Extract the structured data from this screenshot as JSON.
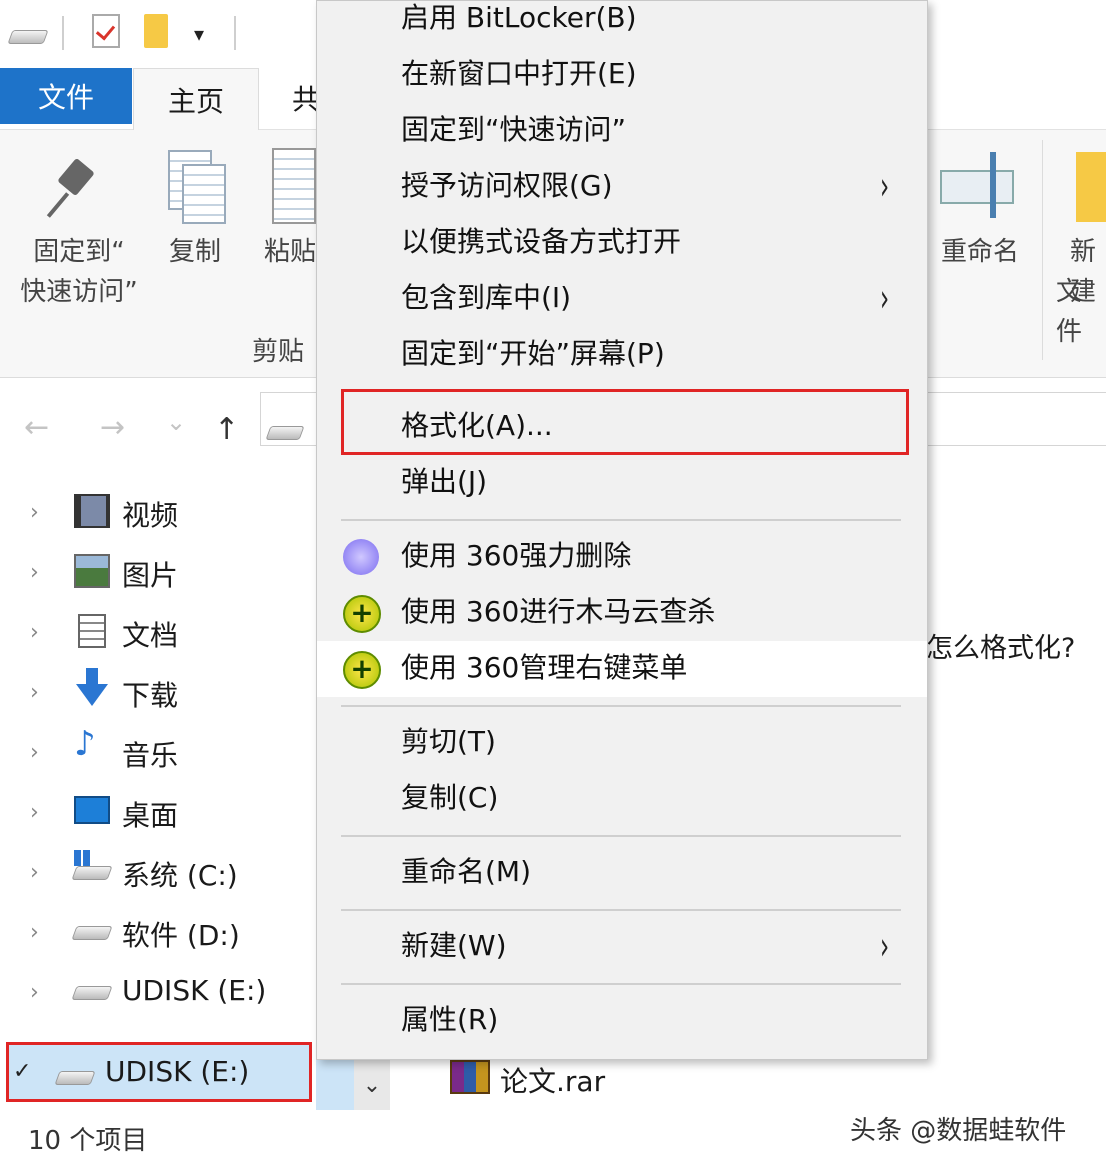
{
  "tabs": {
    "file": "文件",
    "home": "主页",
    "share": "共"
  },
  "ribbon": {
    "pin_line1": "固定到“",
    "pin_line2": "快速访问”",
    "copy": "复制",
    "paste": "粘贴",
    "clipboard_group": "剪贴",
    "rename": "重命名",
    "new_line1": "新建",
    "new_line2": "文件"
  },
  "nav": {
    "back": "←",
    "forward": "→",
    "recent": "⌄",
    "up": "↑"
  },
  "tree": {
    "items": [
      {
        "label": "视频",
        "icon": "video-icon"
      },
      {
        "label": "图片",
        "icon": "pictures-icon"
      },
      {
        "label": "文档",
        "icon": "documents-icon"
      },
      {
        "label": "下载",
        "icon": "download-icon"
      },
      {
        "label": "音乐",
        "icon": "music-icon"
      },
      {
        "label": "桌面",
        "icon": "desktop-icon"
      },
      {
        "label": "系统 (C:)",
        "icon": "system-drive-icon"
      },
      {
        "label": "软件 (D:)",
        "icon": "drive-icon"
      },
      {
        "label": "UDISK (E:)",
        "icon": "usb-drive-icon"
      }
    ],
    "selected": "UDISK (E:)"
  },
  "content": {
    "partial_text": "怎么格式化?",
    "file_name": "论文.rar"
  },
  "status": "10 个项目",
  "watermark": "头条 @数据蛙软件",
  "menu": {
    "bitlocker": "启用 BitLocker(B)",
    "open_new_window": "在新窗口中打开(E)",
    "pin_quick": "固定到“快速访问”",
    "grant_access": "授予访问权限(G)",
    "open_portable": "以便携式设备方式打开",
    "include_library": "包含到库中(I)",
    "pin_start": "固定到“开始”屏幕(P)",
    "format": "格式化(A)...",
    "eject": "弹出(J)",
    "del360": "使用 360强力删除",
    "scan360": "使用 360进行木马云查杀",
    "manage360": "使用 360管理右键菜单",
    "cut": "剪切(T)",
    "copy": "复制(C)",
    "rename": "重命名(M)",
    "new": "新建(W)",
    "properties": "属性(R)",
    "submenu_arrow": "›"
  }
}
